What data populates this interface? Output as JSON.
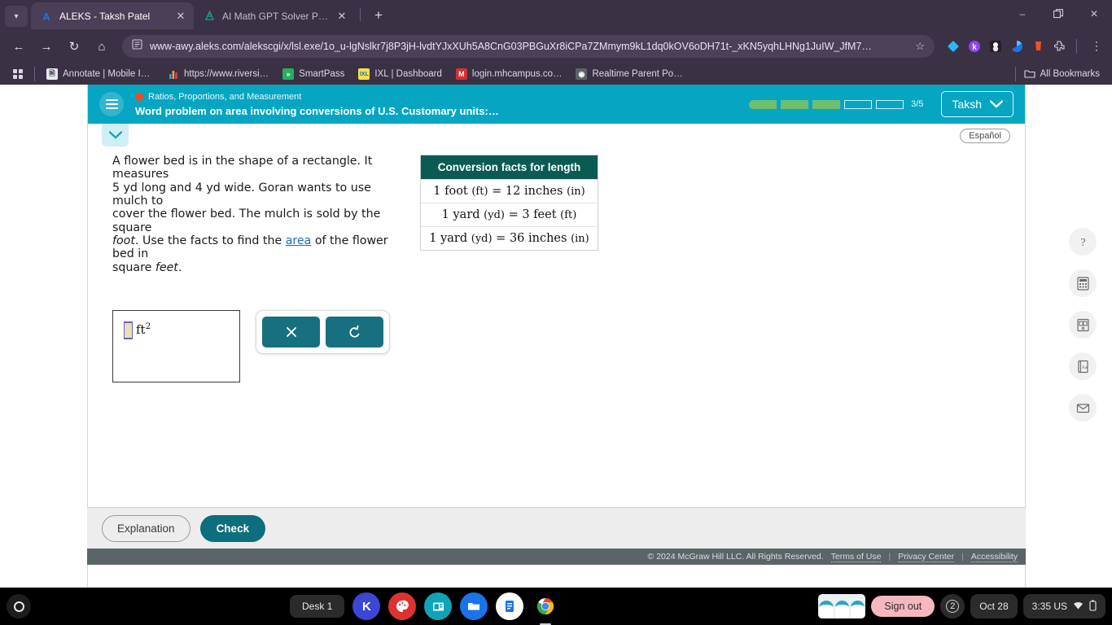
{
  "browser": {
    "tabs": [
      {
        "title": "ALEKS - Taksh Patel",
        "favicon": "aleks-a-icon",
        "active": true
      },
      {
        "title": "AI Math GPT Solver Powered b",
        "favicon": "math-gpt-icon",
        "active": false
      }
    ],
    "new_tab_label": "+",
    "nav": {
      "back": "←",
      "forward": "→",
      "reload": "↻",
      "home": "⌂"
    },
    "omnibox": {
      "url": "www-awy.aleks.com/alekscgi/x/lsl.exe/1o_u-lgNslkr7j8P3jH-lvdtYJxXUh5A8CnG03PBGuXr8iCPa7ZMmym9kL1dq0kOV6oDH71t-_xKN5yqhLHNg1JuIW_JfM7…",
      "star": "☆",
      "site_icon": "page-icon"
    },
    "window_controls": {
      "minimize": "–",
      "maximize": "❐",
      "close": "✕"
    },
    "bookmarks": [
      {
        "label": "Annotate | Mobile In…",
        "icon_text": "🗎",
        "icon_color": "#e8e8f0"
      },
      {
        "label": "https://www.riversi…",
        "icon_text": "▐",
        "icon_color": "#ff8a3d"
      },
      {
        "label": "SmartPass",
        "icon_text": "»",
        "icon_color": "#27ae60"
      },
      {
        "label": "IXL | Dashboard",
        "icon_text": "IXL",
        "icon_color": "#f7e04b"
      },
      {
        "label": "login.mhcampus.co…",
        "icon_text": "M",
        "icon_color": "#d32f2f"
      },
      {
        "label": "Realtime Parent Por…",
        "icon_text": "◔",
        "icon_color": "#9aa0a6"
      }
    ],
    "all_bookmarks_label": "All Bookmarks",
    "extensions": [
      {
        "name": "diamond-extension-icon",
        "glyph": "◆",
        "color": "#29b6f6"
      },
      {
        "name": "kami-extension-icon",
        "glyph": "k",
        "color": "#8e44ec"
      },
      {
        "name": "penguin-extension-icon",
        "glyph": "♟",
        "color": "#23202c"
      },
      {
        "name": "blue-circle-extension-icon",
        "glyph": "◕",
        "color": "#1a73e8"
      },
      {
        "name": "orange-extension-icon",
        "glyph": "▰",
        "color": "#f4511e"
      },
      {
        "name": "puzzle-extensions-icon",
        "glyph": "⬚",
        "color": "#d9d0e3"
      }
    ],
    "menu_glyph": "⋮"
  },
  "aleks": {
    "menu_icon": "hamburger-menu-icon",
    "topic": "Ratios, Proportions, and Measurement",
    "title": "Word problem on area involving conversions of U.S. Customary units:…",
    "progress": {
      "total": 5,
      "filled": 3,
      "label": "3/5"
    },
    "user": {
      "name": "Taksh",
      "chevron": "▼"
    },
    "collapse_chevron": "▼",
    "espanol_label": "Español",
    "problem": {
      "line1": "A flower bed is in the shape of a rectangle. It measures",
      "line2": "5 yd long and 4 yd wide. Goran wants to use mulch to",
      "line3": "cover the flower bed. The mulch is sold by the square",
      "line4_a": "foot",
      "line4_b": ". Use the facts to find the ",
      "line4_link": "area",
      "line4_c": " of the flower bed in",
      "line5_a": "square ",
      "line5_b": "feet",
      "line5_c": "."
    },
    "facts": {
      "heading": "Conversion facts for length",
      "rows": [
        {
          "left_qty": "1",
          "left_unit": "foot",
          "left_abbr": "(ft)",
          "eq": "=",
          "right_qty": "12",
          "right_unit": "inches",
          "right_abbr": "(in)"
        },
        {
          "left_qty": "1",
          "left_unit": "yard",
          "left_abbr": "(yd)",
          "eq": "=",
          "right_qty": "3",
          "right_unit": "feet",
          "right_abbr": "(ft)"
        },
        {
          "left_qty": "1",
          "left_unit": "yard",
          "left_abbr": "(yd)",
          "eq": "=",
          "right_qty": "36",
          "right_unit": "inches",
          "right_abbr": "(in)"
        }
      ]
    },
    "answer": {
      "value": "",
      "unit": "ft",
      "exponent": "2"
    },
    "keypad": {
      "clear_glyph": "✕",
      "undo_glyph": "↺"
    },
    "tools": [
      {
        "name": "help-icon",
        "glyph": "?"
      },
      {
        "name": "calculator-icon",
        "glyph": "▦"
      },
      {
        "name": "reference-book-icon",
        "glyph": "⌷"
      },
      {
        "name": "dictionary-icon",
        "glyph": "Aa"
      },
      {
        "name": "mail-icon",
        "glyph": "✉"
      }
    ],
    "footer": {
      "explanation_label": "Explanation",
      "check_label": "Check"
    },
    "copyright": {
      "text": "© 2024 McGraw Hill LLC. All Rights Reserved.",
      "terms": "Terms of Use",
      "privacy": "Privacy Center",
      "accessibility": "Accessibility",
      "sep": "|"
    }
  },
  "shelf": {
    "desk_label": "Desk 1",
    "apps": [
      {
        "name": "kami-app-icon",
        "glyph": "K",
        "color": "#3b47d4"
      },
      {
        "name": "paint-app-icon",
        "glyph": "🎨",
        "color": "#e03131"
      },
      {
        "name": "slides-app-icon",
        "glyph": "▤",
        "color": "#11a4b8"
      },
      {
        "name": "files-app-icon",
        "glyph": "🗀",
        "color": "#1a73e8"
      },
      {
        "name": "docs-app-icon",
        "glyph": "☰",
        "color": "#ffffff"
      },
      {
        "name": "chrome-app-icon",
        "glyph": "◎",
        "color": "#ffffff"
      }
    ],
    "signout_label": "Sign out",
    "notification_count": "2",
    "date": "Oct 28",
    "time": "3:35 US",
    "wifi_glyph": "▼",
    "battery_glyph": "▐"
  }
}
